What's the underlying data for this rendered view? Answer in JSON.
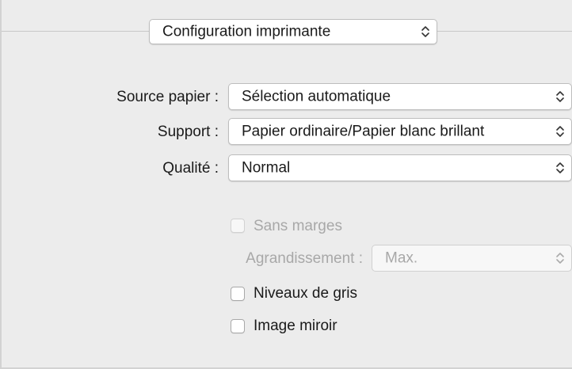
{
  "section_menu": {
    "value": "Configuration imprimante"
  },
  "form": {
    "source": {
      "label": "Source papier :",
      "value": "Sélection automatique"
    },
    "support": {
      "label": "Support :",
      "value": "Papier ordinaire/Papier blanc brillant"
    },
    "quality": {
      "label": "Qualité :",
      "value": "Normal"
    }
  },
  "options": {
    "borderless": {
      "label": "Sans marges",
      "checked": false,
      "enabled": false
    },
    "enlargement": {
      "label": "Agrandissement :",
      "value": "Max.",
      "enabled": false
    },
    "grayscale": {
      "label": "Niveaux de gris",
      "checked": false,
      "enabled": true
    },
    "mirror": {
      "label": "Image miroir",
      "checked": false,
      "enabled": true
    }
  },
  "icons": {
    "popup_arrows": "chevron-up-down-icon"
  },
  "colors": {
    "panel_bg": "#ececec",
    "disabled_text": "#a8a8a8"
  }
}
